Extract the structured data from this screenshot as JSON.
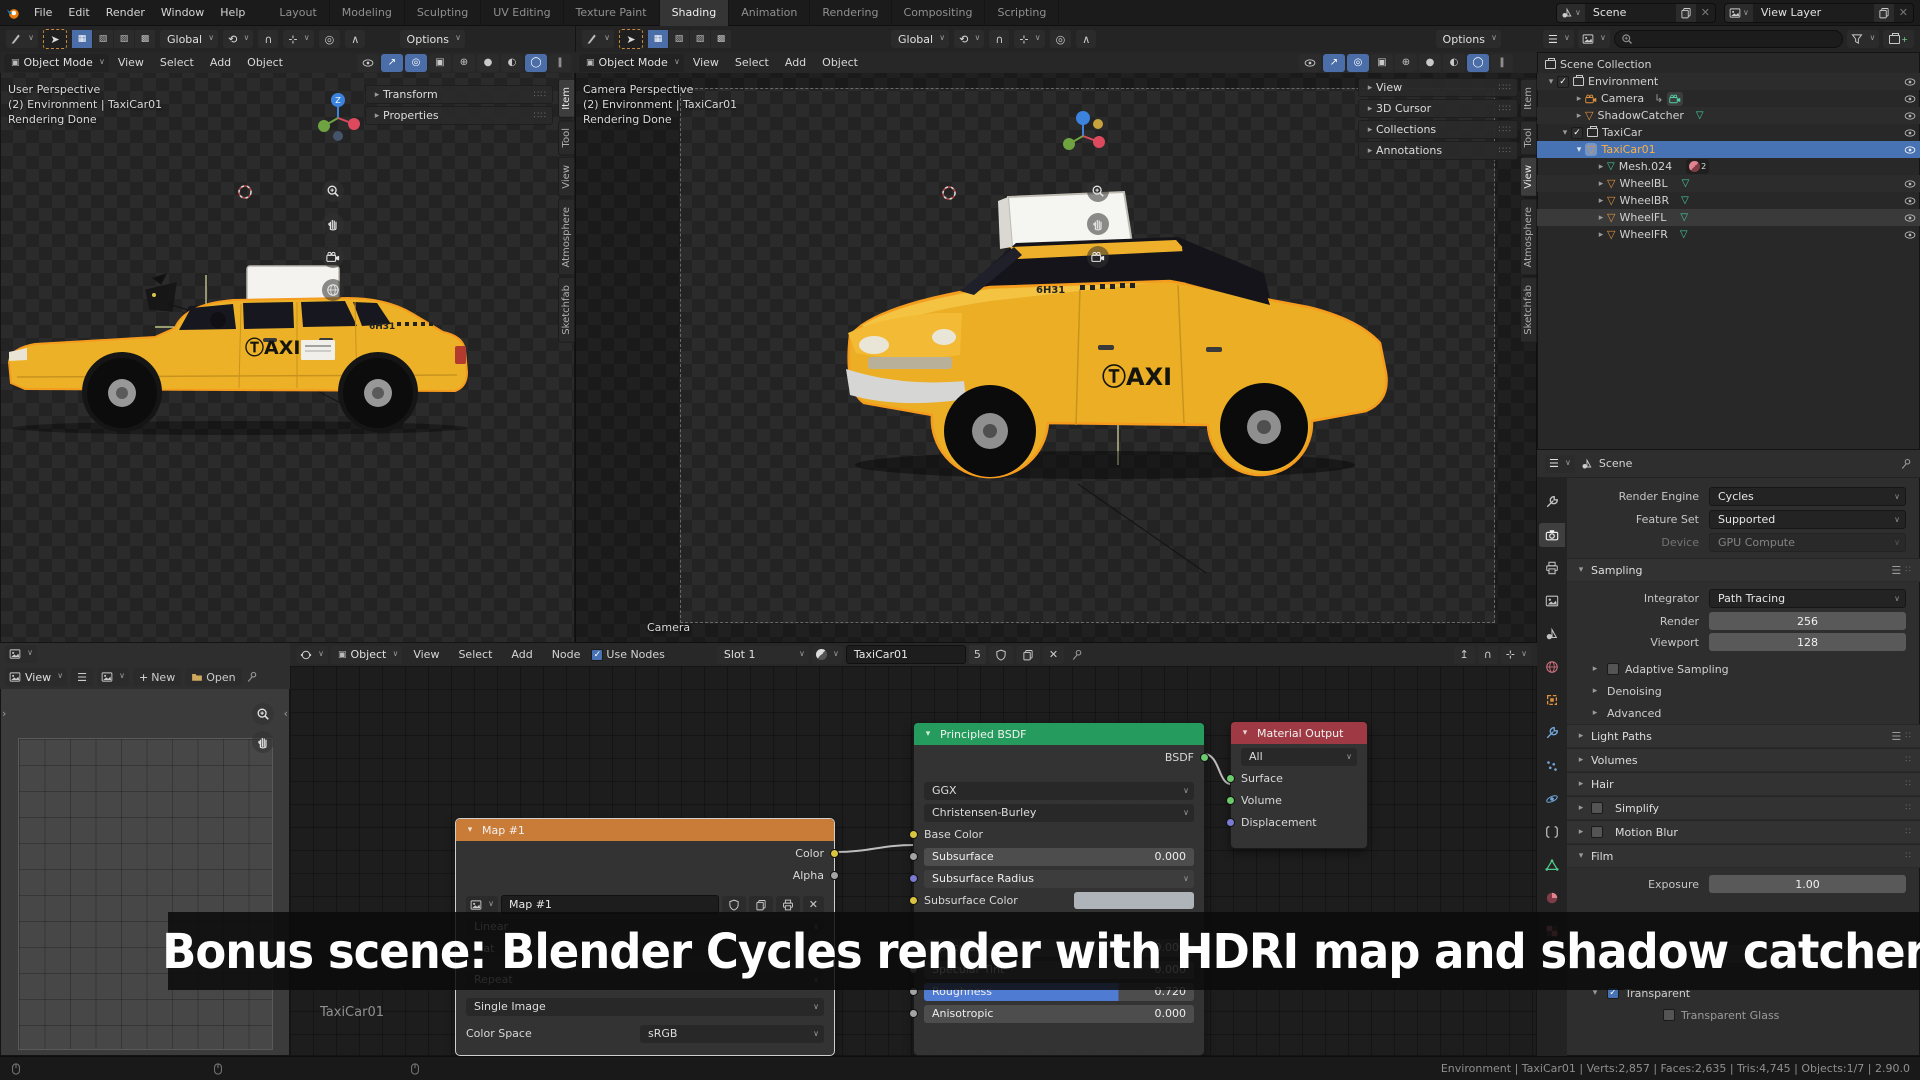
{
  "topbar": {
    "menus": [
      "File",
      "Edit",
      "Render",
      "Window",
      "Help"
    ],
    "workspaces": [
      "Layout",
      "Modeling",
      "Sculpting",
      "UV Editing",
      "Texture Paint",
      "Shading",
      "Animation",
      "Rendering",
      "Compositing",
      "Scripting"
    ],
    "active_workspace": "Shading",
    "scene_selector": {
      "label": "Scene"
    },
    "view_layer_selector": {
      "label": "View Layer"
    }
  },
  "viewport_left": {
    "tools": {
      "orientation": "Global",
      "options_label": "Options"
    },
    "header": {
      "mode": "Object Mode",
      "menus": [
        "View",
        "Select",
        "Add",
        "Object"
      ]
    },
    "overlay": {
      "line1": "User Perspective",
      "line2": "(2) Environment | TaxiCar01",
      "line3": "Rendering Done"
    },
    "npanel": {
      "panels": [
        "Transform",
        "Properties"
      ],
      "tabs": [
        "Item",
        "Tool",
        "View",
        "Atmosphere",
        "Sketchfab"
      ]
    }
  },
  "viewport_right": {
    "tools": {
      "orientation": "Global",
      "options_label": "Options"
    },
    "header": {
      "mode": "Object Mode",
      "menus": [
        "View",
        "Select",
        "Add",
        "Object"
      ]
    },
    "overlay": {
      "line1": "Camera Perspective",
      "line2": "(2) Environment | TaxiCar01",
      "line3": "Rendering Done"
    },
    "camera_label": "Camera",
    "npanel": {
      "panels": [
        "View",
        "3D Cursor",
        "Collections",
        "Annotations"
      ],
      "tabs": [
        "Item",
        "Tool",
        "View",
        "Atmosphere",
        "Sketchfab"
      ]
    }
  },
  "outliner": {
    "rows": [
      {
        "label": "Scene Collection"
      },
      {
        "label": "Environment"
      },
      {
        "label": "Camera"
      },
      {
        "label": "ShadowCatcher"
      },
      {
        "label": "TaxiCar"
      },
      {
        "label": "TaxiCar01"
      },
      {
        "label": "Mesh.024",
        "badge": "2"
      },
      {
        "label": "WheelBL"
      },
      {
        "label": "WheelBR"
      },
      {
        "label": "WheelFL"
      },
      {
        "label": "WheelFR"
      }
    ]
  },
  "properties": {
    "header_title": "Scene",
    "render_engine": {
      "label": "Render Engine",
      "value": "Cycles"
    },
    "feature_set": {
      "label": "Feature Set",
      "value": "Supported"
    },
    "device": {
      "label": "Device",
      "value": "GPU Compute"
    },
    "sampling": {
      "title": "Sampling",
      "integrator_label": "Integrator",
      "integrator": "Path Tracing",
      "render_label": "Render",
      "render": "256",
      "viewport_label": "Viewport",
      "viewport": "128",
      "sub": [
        "Adaptive Sampling",
        "Denoising",
        "Advanced"
      ]
    },
    "sections": [
      "Light Paths",
      "Volumes",
      "Hair",
      "Simplify",
      "Motion Blur"
    ],
    "film": {
      "title": "Film",
      "exposure_label": "Exposure",
      "exposure": "1.00",
      "transparent": "Transparent",
      "transparent_glass": "Transparent Glass"
    }
  },
  "node_editor": {
    "header": {
      "context": "Object",
      "menus": [
        "View",
        "Select",
        "Add",
        "Node"
      ],
      "use_nodes": "Use Nodes",
      "slot": "Slot 1",
      "material": "TaxiCar01",
      "users": "5"
    },
    "tree_label": "TaxiCar01",
    "map_node": {
      "title": "Map #1",
      "outputs": [
        "Color",
        "Alpha"
      ],
      "image_name": "Map #1",
      "interpolation": "Linear",
      "extension": "Flat",
      "repeat": "Repeat",
      "source": "Single Image",
      "color_space_label": "Color Space",
      "color_space": "sRGB"
    },
    "principled": {
      "title": "Principled BSDF",
      "output": "BSDF",
      "distribution": "GGX",
      "subsurface_method": "Christensen-Burley",
      "base_color": "Base Color",
      "subsurface": {
        "label": "Subsurface",
        "value": "0.000"
      },
      "subsurface_radius": "Subsurface Radius",
      "subsurface_color": "Subsurface Color",
      "specular": {
        "label": "Specular",
        "value": "0.000"
      },
      "specular_tint": {
        "label": "Specular Tint",
        "value": "0.000"
      },
      "roughness": {
        "label": "Roughness",
        "value": "0.720"
      },
      "anisotropic": {
        "label": "Anisotropic",
        "value": "0.000"
      }
    },
    "material_output": {
      "title": "Material Output",
      "target": "All",
      "inputs": [
        "Surface",
        "Volume",
        "Displacement"
      ]
    }
  },
  "image_editor": {
    "view": "View",
    "new_label": "New",
    "open_label": "Open"
  },
  "caption": "Bonus scene: Blender Cycles render with HDRI map and shadow catcher",
  "taxi": {
    "logo": "ⓉAXI",
    "plate": "6H31"
  },
  "statusbar": {
    "info": "Environment | TaxiCar01 | Verts:2,857 | Faces:2,635 | Tris:4,745 | Objects:1/7 | 2.90.0"
  },
  "colors": {
    "accent_select": "#4772b3",
    "active_object": "#ffb043",
    "node_shader": "#259c5d",
    "node_output": "#9f3a44",
    "node_texture": "#c97c38",
    "roughness_fill": "#4f7cd2"
  }
}
